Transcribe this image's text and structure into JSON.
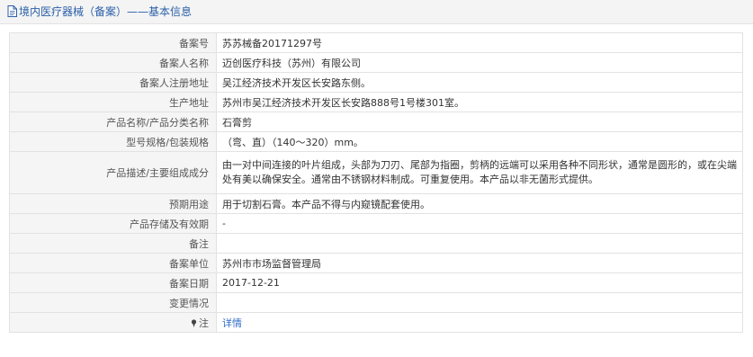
{
  "header": {
    "title": "境内医疗器械（备案）——基本信息"
  },
  "rows": [
    {
      "label": "备案号",
      "value": "苏苏械备20171297号"
    },
    {
      "label": "备案人名称",
      "value": "迈创医疗科技（苏州）有限公司"
    },
    {
      "label": "备案人注册地址",
      "value": "吴江经济技术开发区长安路东侧。"
    },
    {
      "label": "生产地址",
      "value": "苏州市吴江经济技术开发区长安路888号1号楼301室。"
    },
    {
      "label": "产品名称/产品分类名称",
      "value": "石膏剪"
    },
    {
      "label": "型号规格/包装规格",
      "value": "（弯、直）（140～320）mm。"
    },
    {
      "label": "产品描述/主要组成成分",
      "value": "由一对中间连接的叶片组成，头部为刀刃、尾部为指圈，剪柄的远端可以采用各种不同形状，通常是圆形的，或在尖端处有美以确保安全。通常由不锈钢材料制成。可重复使用。本产品以非无菌形式提供。"
    },
    {
      "label": "预期用途",
      "value": "用于切割石膏。本产品不得与内窥镜配套使用。"
    },
    {
      "label": "产品存储及有效期",
      "value": "-"
    },
    {
      "label": "备注",
      "value": ""
    },
    {
      "label": "备案单位",
      "value": "苏州市市场监督管理局"
    },
    {
      "label": "备案日期",
      "value": "2017-12-21"
    },
    {
      "label": "变更情况",
      "value": ""
    }
  ],
  "note": {
    "label": "注",
    "link_text": "详情",
    "icon": "pin-icon"
  }
}
